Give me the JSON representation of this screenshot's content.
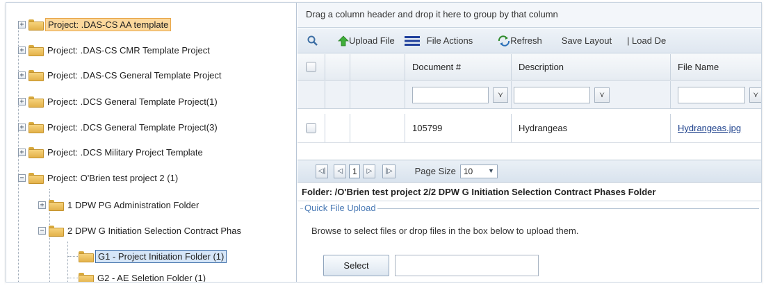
{
  "tree": {
    "nodes": [
      {
        "expander": "+",
        "label": "Project: .DAS-CS AA template"
      },
      {
        "expander": "+",
        "label": "Project: .DAS-CS CMR Template Project"
      },
      {
        "expander": "+",
        "label": "Project: .DAS-CS General Template Project"
      },
      {
        "expander": "+",
        "label": "Project: .DCS General Template Project(1)"
      },
      {
        "expander": "+",
        "label": "Project: .DCS General Template Project(3)"
      },
      {
        "expander": "+",
        "label": "Project: .DCS Military Project Template"
      },
      {
        "expander": "−",
        "label": "Project: O'Brien test project 2 (1)"
      },
      {
        "expander": "+",
        "label": "1 DPW PG Administration Folder"
      },
      {
        "expander": "−",
        "label": "2 DPW G Initiation Selection Contract Phas"
      },
      {
        "expander": "",
        "label": "G1 - Project Initiation Folder (1)"
      },
      {
        "expander": "",
        "label": "G2 - AE Seletion Folder (1)"
      }
    ]
  },
  "grid": {
    "group_hint": "Drag a column header and drop it here to group by that column",
    "toolbar": {
      "upload": "Upload File",
      "file_actions": "File Actions",
      "refresh": "Refresh",
      "save_layout": "Save Layout",
      "load": "| Load De"
    },
    "columns": [
      "Document #",
      "Description",
      "File Name"
    ],
    "rows": [
      {
        "document": "105799",
        "description": "Hydrangeas",
        "file_name": "Hydrangeas.jpg"
      }
    ],
    "pager": {
      "first": "◁|",
      "prev": "◁",
      "page": "1",
      "next": "▷",
      "last": "|▷",
      "page_size_label": "Page Size",
      "page_size_value": "10"
    },
    "folder_path": "Folder: /O'Brien test project 2/2 DPW G Initiation Selection Contract Phases Folder",
    "quick_upload": {
      "legend": "Quick File Upload",
      "hint": "Browse to select files or drop files in the box below to upload them.",
      "select_label": "Select",
      "field_value": ""
    }
  },
  "colors": {
    "accent": "#4a7ab5",
    "selected_orange": "#fbd89c",
    "selected_blue": "#d6e6f8"
  }
}
